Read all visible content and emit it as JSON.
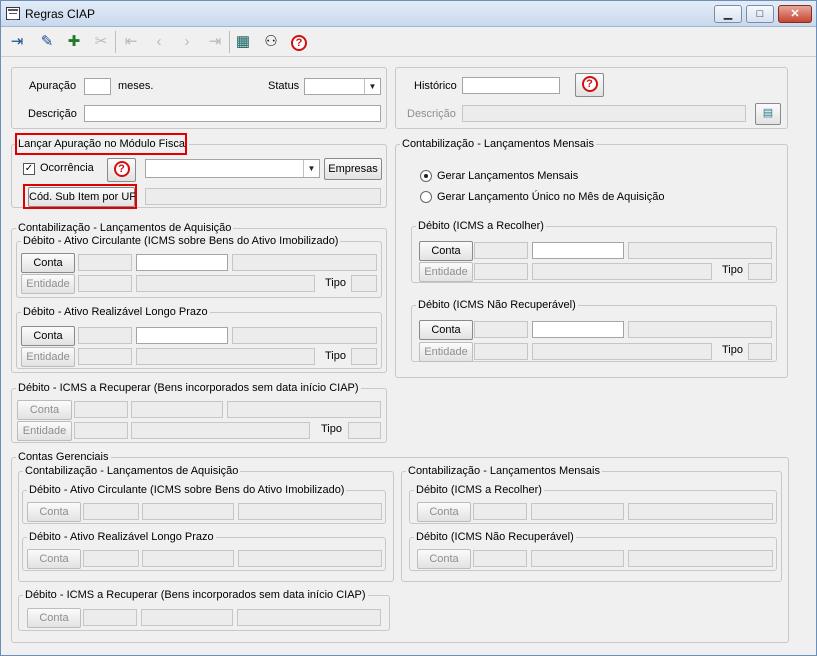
{
  "window": {
    "title": "Regras CIAP",
    "min": "▁",
    "max": "□",
    "close": "✕"
  },
  "toolbar": {
    "exit": "exit-icon",
    "edit": "pencil-icon",
    "new": "new-record-icon",
    "delete": "delete-icon",
    "first": "first-record-icon",
    "prev": "previous-record-icon",
    "next": "next-record-icon",
    "last": "last-record-icon",
    "grid": "grid-icon",
    "search": "binoculars-icon",
    "help": "help-icon"
  },
  "top_left": {
    "apuracao_label": "Apuração",
    "meses_label": "meses.",
    "apuracao_value": "",
    "status_label": "Status",
    "status_value": "",
    "descricao_label": "Descrição",
    "descricao_value": ""
  },
  "top_right": {
    "historico_label": "Histórico",
    "historico_value": "",
    "descricao_label": "Descrição",
    "descricao_value": ""
  },
  "fiscal": {
    "legend": "Lançar Apuração no Módulo Fiscal",
    "ocorrencia_checked": "✓",
    "ocorrencia_label": "Ocorrência",
    "ocorrencia_value": "",
    "empresas_button": "Empresas",
    "sub_item_button": "Cód. Sub Item por UF",
    "sub_item_value": ""
  },
  "contab_aquisicao": {
    "legend": "Contabilização - Lançamentos de Aquisição",
    "ativo_circulante": {
      "legend": "Débito - Ativo Circulante (ICMS sobre Bens do Ativo Imobilizado)",
      "conta": "Conta",
      "entidade": "Entidade",
      "tipo": "Tipo"
    },
    "ativo_realizavel": {
      "legend": "Débito - Ativo Realizável Longo Prazo",
      "conta": "Conta",
      "entidade": "Entidade",
      "tipo": "Tipo"
    }
  },
  "icms_recuperar": {
    "legend": "Débito - ICMS a Recuperar (Bens incorporados sem data início CIAP)",
    "conta": "Conta",
    "entidade": "Entidade",
    "tipo": "Tipo"
  },
  "contab_mensais": {
    "legend": "Contabilização - Lançamentos Mensais",
    "radio1": "Gerar Lançamentos Mensais",
    "radio2": "Gerar Lançamento Único no Mês de Aquisição",
    "icms_recolher": {
      "legend": "Débito (ICMS a Recolher)",
      "conta": "Conta",
      "entidade": "Entidade",
      "tipo": "Tipo"
    },
    "icms_nao_recuperavel": {
      "legend": "Débito (ICMS Não Recuperável)",
      "conta": "Conta",
      "entidade": "Entidade",
      "tipo": "Tipo"
    }
  },
  "gerenciais": {
    "legend": "Contas Gerenciais",
    "aquisicao": {
      "legend": "Contabilização - Lançamentos de Aquisição",
      "ativo_circulante": {
        "legend": "Débito - Ativo Circulante (ICMS sobre Bens do Ativo Imobilizado)",
        "conta": "Conta"
      },
      "ativo_realizavel": {
        "legend": "Débito - Ativo Realizável Longo Prazo",
        "conta": "Conta"
      }
    },
    "mensais": {
      "legend": "Contabilização - Lançamentos Mensais",
      "icms_recolher": {
        "legend": "Débito (ICMS a Recolher)",
        "conta": "Conta"
      },
      "icms_nao_recuperavel": {
        "legend": "Débito (ICMS Não Recuperável)",
        "conta": "Conta"
      }
    },
    "icms_recuperar": {
      "legend": "Débito - ICMS a Recuperar (Bens incorporados sem data início CIAP)",
      "conta": "Conta"
    }
  }
}
